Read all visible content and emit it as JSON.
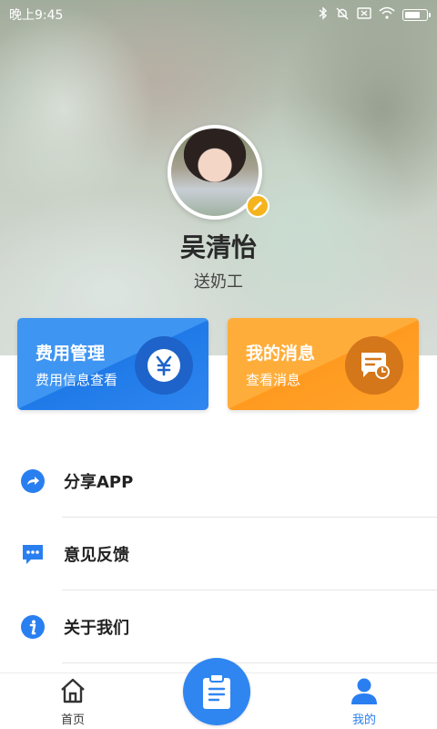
{
  "status_bar": {
    "time": "晚上9:45",
    "icons": [
      "bluetooth-icon",
      "mute-icon",
      "sim-icon",
      "wifi-icon",
      "battery-charging-icon"
    ]
  },
  "profile": {
    "name": "吴清怡",
    "role": "送奶工",
    "avatar_icon": "avatar",
    "edit_icon": "pencil-icon"
  },
  "cards": {
    "fee": {
      "title": "费用管理",
      "subtitle": "费用信息查看",
      "icon": "yen-icon",
      "color": "#3f95f2"
    },
    "message": {
      "title": "我的消息",
      "subtitle": "查看消息",
      "icon": "message-clock-icon",
      "color": "#ffad3a"
    }
  },
  "menu": [
    {
      "label": "分享APP",
      "icon": "share-icon"
    },
    {
      "label": "意见反馈",
      "icon": "feedback-icon"
    },
    {
      "label": "关于我们",
      "icon": "info-icon"
    }
  ],
  "bottom_nav": {
    "home_label": "首页",
    "mine_label": "我的",
    "center_icon": "clipboard-icon",
    "active": "我的",
    "accent": "#2f86f0"
  }
}
